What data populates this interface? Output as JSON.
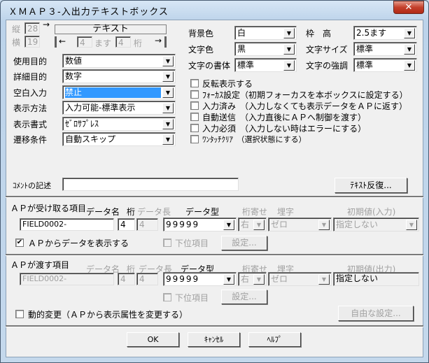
{
  "window": {
    "title": "ＸＭＡＰ３-入出力テキストボックス",
    "close_icon": "close-icon"
  },
  "geometry": {
    "tate_label": "縦",
    "tate_value": "28",
    "yoko_label": "横",
    "yoko_value": "19",
    "arrow_right": "→",
    "arrow_left": "←",
    "text_label": "テキスト",
    "cols_value": "4",
    "masu_label": "ます",
    "keta_value": "4",
    "keta_label": "桁"
  },
  "left_fields": [
    {
      "label": "使用目的",
      "value": "数値"
    },
    {
      "label": "詳細目的",
      "value": "数字"
    },
    {
      "label": "空白入力",
      "value": "禁止"
    },
    {
      "label": "表示方法",
      "value": "入力可能-標準表示"
    },
    {
      "label": "表示書式",
      "value": "ｾﾞﾛｻﾌﾟﾚｽ"
    },
    {
      "label": "遷移条件",
      "value": "自動スキップ"
    }
  ],
  "right_fields": [
    {
      "label": "背景色",
      "value": "白"
    },
    {
      "label": "枠　高",
      "value": "2.5ます"
    },
    {
      "label": "文字色",
      "value": "黒"
    },
    {
      "label": "文字サイズ",
      "value": "標準"
    },
    {
      "label": "文字の書体",
      "value": "標準"
    },
    {
      "label": "文字の強調",
      "value": "標準"
    }
  ],
  "options": [
    {
      "label": "反転表示する",
      "checked": false
    },
    {
      "label": "ﾌｫｰｶｽ設定（初期フォーカスを本ボックスに設定する）",
      "checked": false
    },
    {
      "label": "入力済み　（入力しなくても表示データをＡＰに返す）",
      "checked": false
    },
    {
      "label": "自動送信　（入力直後にＡＰへ制御を渡す）",
      "checked": false
    },
    {
      "label": "入力必須　（入力しない時はエラーにする）",
      "checked": false
    },
    {
      "label": "ﾜﾝﾀｯﾁｸﾘｱ　（選択状態にする）",
      "checked": false
    }
  ],
  "comment": {
    "label": "ｺﾒﾝﾄの記述",
    "value": "",
    "button": "ﾃｷｽﾄ反復..."
  },
  "headers": {
    "data_name": "データ名",
    "keta": "桁",
    "data_len": "データ長",
    "data_type": "データ型",
    "align": "桁寄せ",
    "fill": "埋字"
  },
  "receive": {
    "title": "ＡＰが受け取る項目",
    "init_header": "初期値(入力)",
    "name": "FIELD0002-",
    "keta": "4",
    "len": "4",
    "type": "99999",
    "align": "右",
    "fill": "ゼロ",
    "init": "指定しない",
    "show_label": "ＡＰからデータを表示する",
    "show_checked": true,
    "sub_label": "下位項目",
    "settings": "設定..."
  },
  "send": {
    "title": "ＡＰが渡す項目",
    "init_header": "初期値(出力)",
    "name": "FIELD0002-",
    "keta": "4",
    "len": "4",
    "type": "99999",
    "align": "右",
    "fill": "ゼロ",
    "init": "指定しない",
    "sub_label": "下位項目",
    "settings": "設定..."
  },
  "dynamic": {
    "label": "動的変更（ＡＰから表示属性を変更する）",
    "checked": false,
    "free_settings": "自由な設定..."
  },
  "footer": {
    "ok": "OK",
    "cancel": "ｷｬﾝｾﾙ",
    "help": "ﾍﾙﾌﾟ"
  },
  "colors": {
    "selection": "#3399ff",
    "title_bar": "#c4d8ec",
    "close": "#c4402c"
  }
}
